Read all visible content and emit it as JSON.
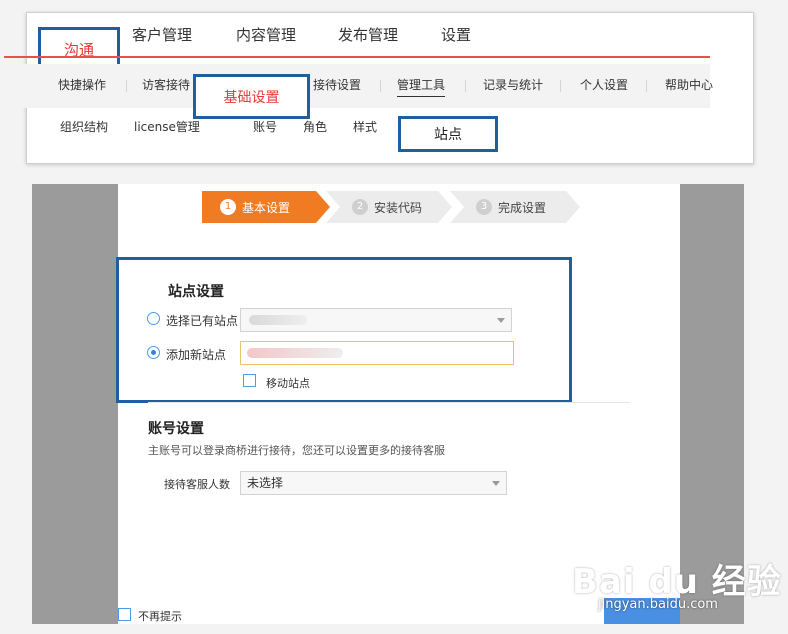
{
  "top_nav": {
    "items": [
      "沟通",
      "客户管理",
      "内容管理",
      "发布管理",
      "设置"
    ]
  },
  "sub_nav": {
    "items": [
      "快捷操作",
      "访客接待",
      "基础设置",
      "接待设置",
      "管理工具",
      "记录与统计",
      "个人设置",
      "帮助中心"
    ]
  },
  "third_nav": {
    "items": [
      "组织结构",
      "license管理",
      "账号",
      "角色",
      "样式",
      "站点"
    ]
  },
  "steps": [
    {
      "num": "1",
      "label": "基本设置",
      "active": true
    },
    {
      "num": "2",
      "label": "安装代码",
      "active": false
    },
    {
      "num": "3",
      "label": "完成设置",
      "active": false
    }
  ],
  "site_settings": {
    "title": "站点设置",
    "option_existing": "选择已有站点",
    "option_new": "添加新站点",
    "mobile_site": "移动站点"
  },
  "account_settings": {
    "title": "账号设置",
    "description": "主账号可以登录商桥进行接待，您还可以设置更多的接待客服",
    "agents_label": "接待客服人数",
    "agents_value": "未选择"
  },
  "footer": {
    "dont_remind": "不再提示"
  },
  "watermark": {
    "logo": "Bai du 经验",
    "url": "jingyan.baidu.com"
  },
  "colors": {
    "highlight_border": "#1f5fa0",
    "red_text": "#e53935",
    "active_step": "#f07b22",
    "inactive_step": "#ececec"
  }
}
